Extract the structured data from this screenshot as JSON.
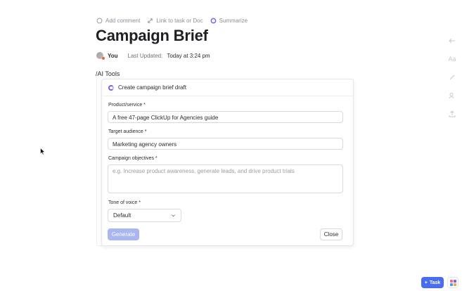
{
  "toolbar": {
    "add_comment": "Add comment",
    "link_task": "Link to task or Doc",
    "summarize": "Summarize"
  },
  "doc": {
    "title": "Campaign Brief",
    "author": "You",
    "last_updated_label": "Last Updated:",
    "last_updated_value": "Today at 3:24 pm",
    "slash_command": "/AI Tools"
  },
  "ai_card": {
    "header": "Create campaign brief draft",
    "fields": [
      {
        "label": "Product/service *",
        "value": "A free 47-page ClickUp for Agencies guide"
      },
      {
        "label": "Target audience *",
        "value": "Marketing agency owners"
      },
      {
        "label": "Campaign objectives *",
        "placeholder": "e.g. Increase product awareness, generate leads, and drive product trials"
      }
    ],
    "tone_label": "Tone of voice *",
    "tone_value": "Default",
    "generate_label": "Generate",
    "close_label": "Close"
  },
  "fab": {
    "task_label": "Task"
  },
  "right_rail": {
    "text_icon_glyph": "Aa"
  },
  "colors": {
    "accent": "#7c5cf5",
    "primary_button": "#4a6cf0",
    "generate_disabled": "#a9b6f0"
  }
}
